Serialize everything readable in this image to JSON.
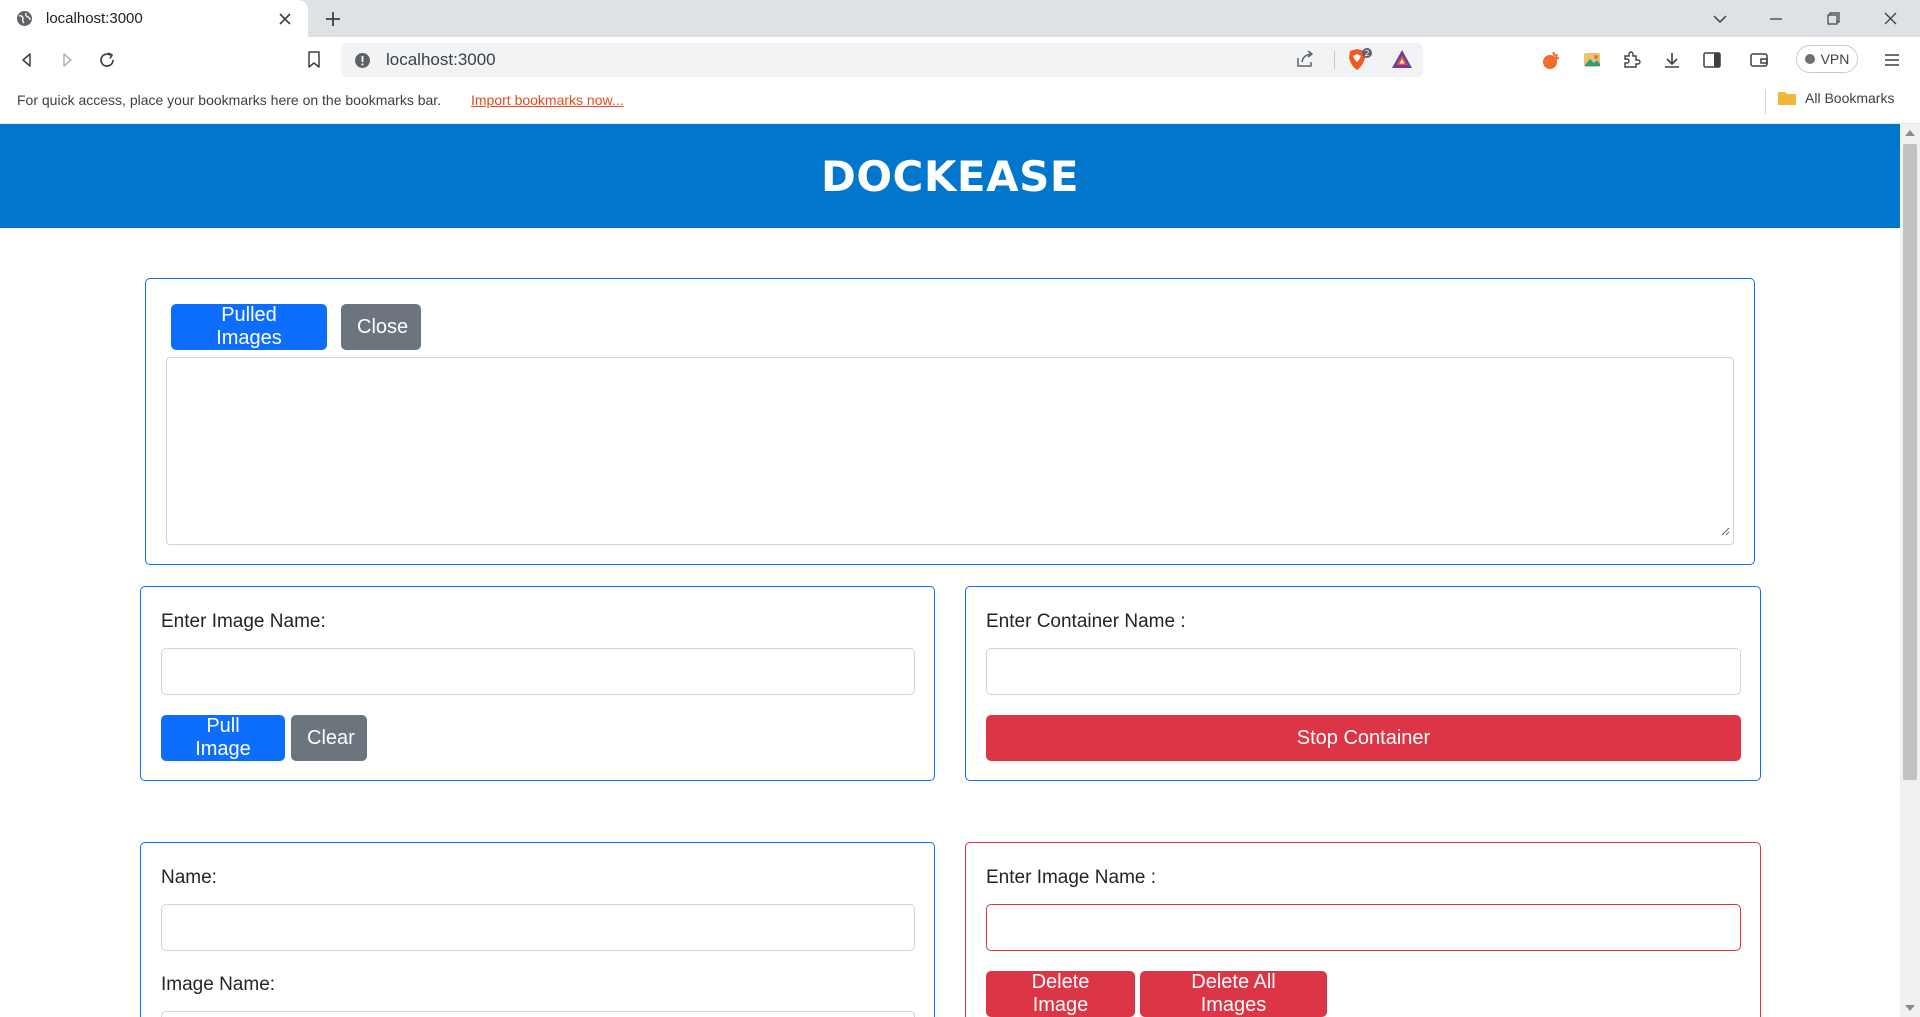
{
  "browser": {
    "tab_title": "localhost:3000",
    "url": "localhost:3000",
    "vpn_label": "VPN",
    "bookmarks_hint": "For quick access, place your bookmarks here on the bookmarks bar.",
    "bookmarks_import": "Import bookmarks now...",
    "all_bookmarks": "All Bookmarks",
    "brave_badge": "2"
  },
  "app": {
    "title": "DOCKEASE",
    "accent_color": "#0077cc"
  },
  "pulled_images_panel": {
    "pulled_button": "Pulled Images",
    "close_button": "Close",
    "output_value": ""
  },
  "pull_panel": {
    "label": "Enter Image Name:",
    "input_value": "",
    "pull_button": "Pull Image",
    "clear_button": "Clear"
  },
  "stop_panel": {
    "label": "Enter Container Name :",
    "input_value": "",
    "stop_button": "Stop Container"
  },
  "run_panel": {
    "name_label": "Name:",
    "name_value": "",
    "image_label": "Image Name:",
    "image_value": ""
  },
  "delete_panel": {
    "label": "Enter Image Name :",
    "input_value": "",
    "delete_button": "Delete Image",
    "delete_all_button": "Delete All Images"
  }
}
